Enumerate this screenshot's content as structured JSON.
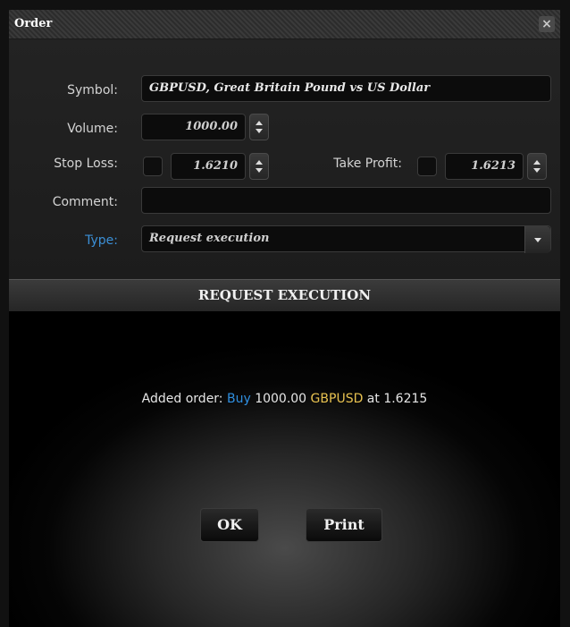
{
  "dialog": {
    "title": "Order"
  },
  "form": {
    "symbol_label": "Symbol:",
    "symbol_value": "GBPUSD, Great Britain Pound vs US Dollar",
    "volume_label": "Volume:",
    "volume_value": "1000.00",
    "stop_loss_label": "Stop Loss:",
    "stop_loss_value": "1.6210",
    "take_profit_label": "Take Profit:",
    "take_profit_value": "1.6213",
    "comment_label": "Comment:",
    "comment_value": "",
    "type_label": "Type:",
    "type_value": "Request execution"
  },
  "section": {
    "title": "REQUEST EXECUTION"
  },
  "result": {
    "prefix": "Added order: ",
    "side": "Buy",
    "volume": " 1000.00 ",
    "symbol": "GBPUSD",
    "at": " at 1.6215"
  },
  "buttons": {
    "ok": "OK",
    "print": "Print"
  },
  "colors": {
    "type_label": "#3b8fd6",
    "buy": "#2f8fe0",
    "symbol": "#e8c250"
  },
  "icons": {
    "close": "close-icon",
    "spinner": "spinner-arrows-icon",
    "dropdown": "chevron-down-icon"
  }
}
